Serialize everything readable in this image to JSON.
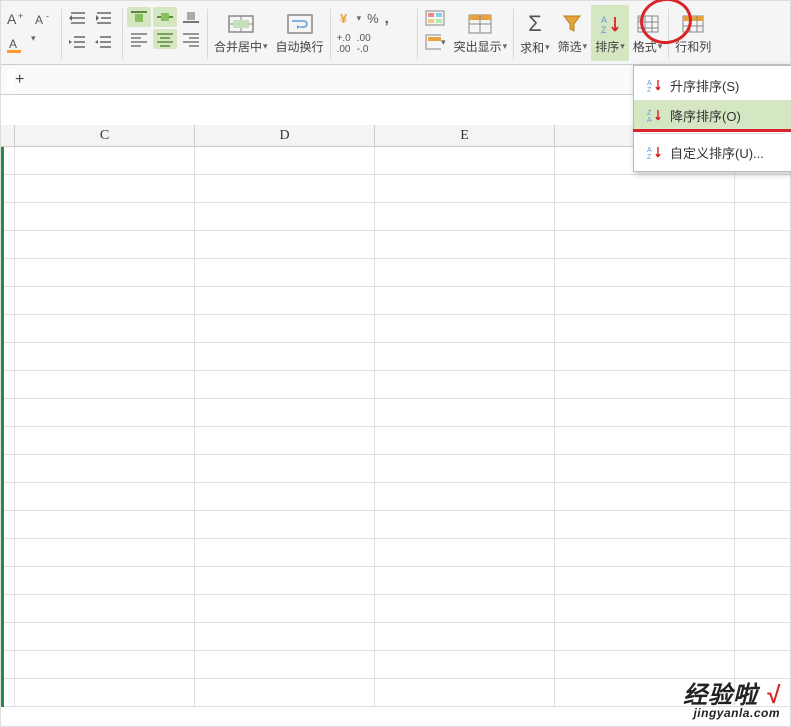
{
  "ribbon": {
    "font": {
      "increase": "A+",
      "decrease": "A-"
    },
    "align": {},
    "merge": {
      "label": "合并居中"
    },
    "wrap": {
      "label": "自动换行"
    },
    "number": {
      "percent": "%",
      "comma": ",",
      "inc_dec": "+.0",
      "dec_dec": ".00"
    },
    "highlight": {
      "label": "突出显示"
    },
    "sum": {
      "label": "求和",
      "sigma": "Σ"
    },
    "filter": {
      "label": "筛选"
    },
    "sort": {
      "label": "排序"
    },
    "format": {
      "label": "格式"
    },
    "rowcol": {
      "label": "行和列"
    }
  },
  "menu": {
    "asc": "升序排序(S)",
    "desc": "降序排序(O)",
    "custom": "自定义排序(U)..."
  },
  "columns": {
    "c": "C",
    "d": "D",
    "e": "E"
  },
  "watermark": {
    "line1a": "经验啦",
    "line1b": "√",
    "line2": "jingyanla.com"
  },
  "namebox_plus": "+"
}
